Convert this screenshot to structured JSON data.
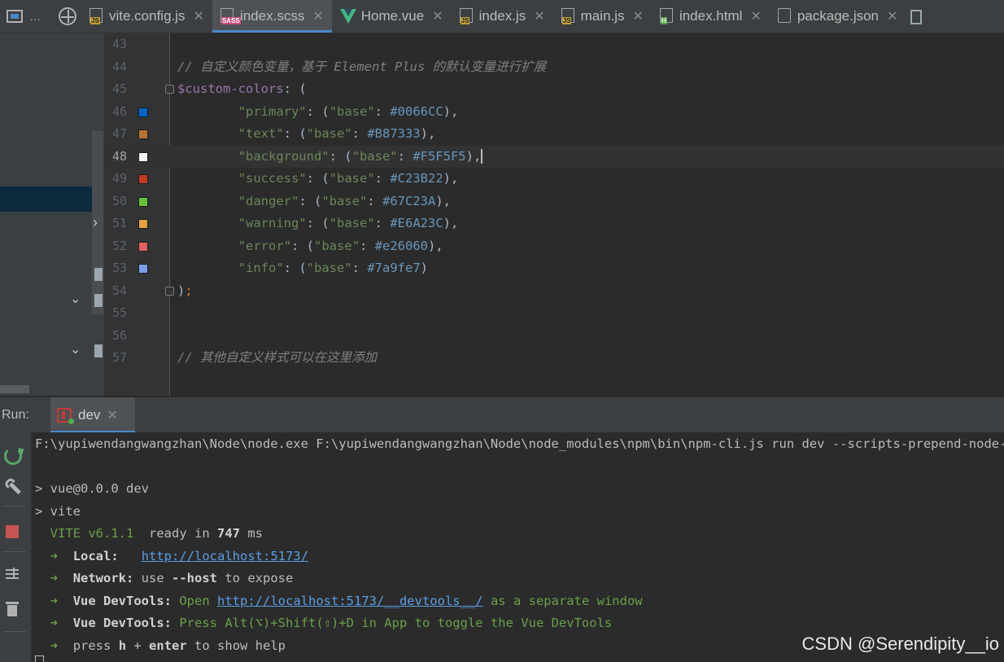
{
  "tabs": [
    {
      "label": "vite.config.js",
      "icon": "js-file-icon",
      "active": false
    },
    {
      "label": "index.scss",
      "icon": "sass-file-icon",
      "active": true
    },
    {
      "label": "Home.vue",
      "icon": "vue-file-icon",
      "active": false
    },
    {
      "label": "index.js",
      "icon": "js-file-icon",
      "active": false
    },
    {
      "label": "main.js",
      "icon": "js-file-icon",
      "active": false
    },
    {
      "label": "index.html",
      "icon": "html-file-icon",
      "active": false
    },
    {
      "label": "package.json",
      "icon": "package-json-icon",
      "active": false
    }
  ],
  "tab_tools": {
    "more": "…"
  },
  "editor": {
    "lines": [
      {
        "num": "43"
      },
      {
        "num": "44",
        "comment": "// 自定义颜色变量，基于 Element Plus 的默认变量进行扩展"
      },
      {
        "num": "45",
        "var": "$custom-colors",
        "rest": ": ("
      },
      {
        "num": "46",
        "key": "\"primary\"",
        "hex": "#0066CC",
        "swatch": "#0066CC",
        "end": "),"
      },
      {
        "num": "47",
        "key": "\"text\"",
        "hex": "#B87333",
        "swatch": "#B87333",
        "end": "),"
      },
      {
        "num": "48",
        "key": "\"background\"",
        "hex": "#F5F5F5",
        "swatch": "#F5F5F5",
        "end": "),"
      },
      {
        "num": "49",
        "key": "\"success\"",
        "hex": "#C23B22",
        "swatch": "#C23B22",
        "end": "),"
      },
      {
        "num": "50",
        "key": "\"danger\"",
        "hex": "#67C23A",
        "swatch": "#67C23A",
        "end": "),"
      },
      {
        "num": "51",
        "key": "\"warning\"",
        "hex": "#E6A23C",
        "swatch": "#E6A23C",
        "end": "),"
      },
      {
        "num": "52",
        "key": "\"error\"",
        "hex": "#e26060",
        "swatch": "#e26060",
        "end": "),"
      },
      {
        "num": "53",
        "key": "\"info\"",
        "hex": "#7a9fe7",
        "swatch": "#7a9fe7",
        "end": ")"
      },
      {
        "num": "54",
        "close": ")",
        "semi": ";"
      },
      {
        "num": "55"
      },
      {
        "num": "56"
      },
      {
        "num": "57",
        "comment": "// 其他自定义样式可以在这里添加"
      }
    ],
    "base_key": "\"base\"",
    "current_line": "48"
  },
  "run": {
    "label": "Run:",
    "tab": "dev",
    "console": {
      "cmd": "F:\\yupiwendangwangzhan\\Node\\node.exe F:\\yupiwendangwangzhan\\Node\\node_modules\\npm\\bin\\npm-cli.js run dev --scripts-prepend-node-path=auto",
      "l1": "> vue@0.0.0 dev",
      "l2": "> vite",
      "vite_name": "VITE v6.1.1",
      "ready_a": "  ready in ",
      "ready_ms": "747",
      "ready_b": " ms",
      "local_label": "Local:",
      "local_url": "http://localhost:5173/",
      "network_label": "Network:",
      "network_a": " use ",
      "network_flag": "--host",
      "network_b": " to expose",
      "dt_label": "Vue DevTools:",
      "dt1_a": " Open ",
      "dt1_url": "http://localhost:5173/__devtools__/",
      "dt1_b": " as a separate window",
      "dt2": " Press Alt(⌥)+Shift(⇧)+D in App to toggle the Vue DevTools",
      "help_a": "press ",
      "help_h": "h",
      "help_plus": " + ",
      "help_enter": "enter",
      "help_b": " to show help",
      "arrow": "➜"
    }
  },
  "watermark": "CSDN @Serendipity__io"
}
